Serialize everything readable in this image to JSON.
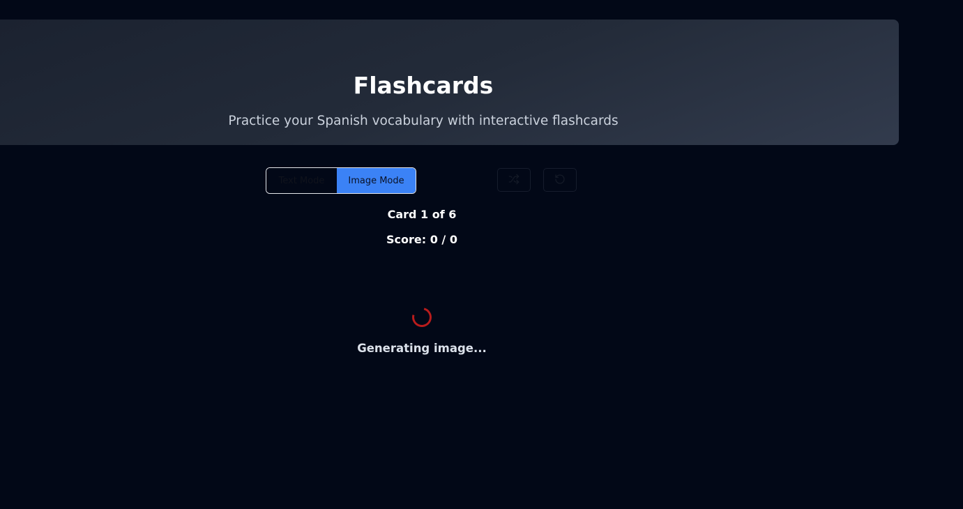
{
  "header": {
    "title": "Flashcards",
    "subtitle": "Practice your Spanish vocabulary with interactive flashcards"
  },
  "controls": {
    "text_mode_label": "Text Mode",
    "image_mode_label": "Image Mode",
    "active_mode": "Image Mode",
    "shuffle_icon": "shuffle-icon",
    "reset_icon": "rotate-ccw-icon"
  },
  "progress": {
    "card_label": "Card 1 of 6",
    "score_label": "Score: 0 / 0"
  },
  "loading": {
    "text": "Generating image..."
  },
  "colors": {
    "background": "#020817",
    "accent": "#3b82f6",
    "spinner": "#b91c1c"
  }
}
